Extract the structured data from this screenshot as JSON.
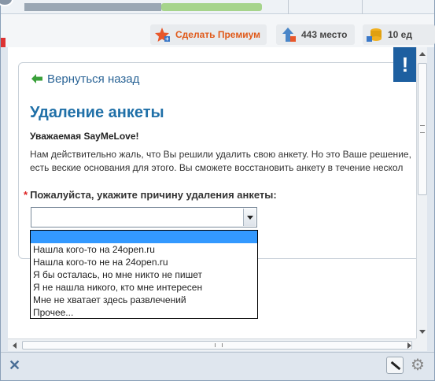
{
  "infobar": {
    "premium_label": "Сделать Премиум",
    "rank_label": "443 место",
    "coins_label": "10 ед"
  },
  "page": {
    "back_link": "Вернуться назад",
    "title": "Удаление анкеты",
    "greeting": "Уважаемая SayMeLove!",
    "paragraph_line1": "Нам действительно жаль, что Вы решили удалить свою анкету. Но это Ваше решение,",
    "paragraph_line2": "есть веские основания для этого. Вы сможете восстановить анкету в течение нескол",
    "required_mark": "*",
    "reason_label": "Пожалуйста, укажите причину удаления анкеты:",
    "alert_badge": "!"
  },
  "select": {
    "value": "",
    "options": [
      "",
      "Нашла кого-то на 24open.ru",
      "Нашла кого-то не на 24open.ru",
      "Я бы осталась, но мне никто не пишет",
      "Я не нашла никого, кто мне интересен",
      "Мне не хватает здесь развлечений",
      "Прочее..."
    ]
  },
  "statusbar": {
    "close_glyph": "✕",
    "gear_glyph": "⚙"
  },
  "colors": {
    "accent": "#2070a8",
    "premium": "#e05a1a",
    "highlight": "#3399ff"
  }
}
